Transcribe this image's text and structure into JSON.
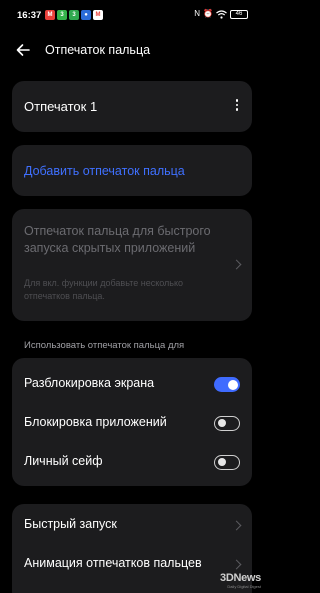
{
  "status_bar": {
    "time": "16:37",
    "apps": [
      {
        "icon": "red-app-icon",
        "color": "#e8403a",
        "glyph": "M"
      },
      {
        "icon": "green-app-icon",
        "color": "#34b34a",
        "glyph": "3"
      },
      {
        "icon": "green-app-icon-2",
        "color": "#2fa84f",
        "glyph": "3"
      },
      {
        "icon": "blue-app-icon",
        "color": "#2b6cd8",
        "glyph": "●"
      },
      {
        "icon": "gmail-icon",
        "color": "#ffffff",
        "glyph": "M"
      }
    ],
    "nfc": "N",
    "alarm": "⏰",
    "wifi": "wifi",
    "battery": "46"
  },
  "header": {
    "title": "Отпечаток пальца"
  },
  "fingerprint_card": {
    "name": "Отпечаток 1"
  },
  "add_card": {
    "label": "Добавить отпечаток пальца"
  },
  "quick_launch_card": {
    "title": "Отпечаток пальца для быстрого запуска скрытых приложений",
    "description": "Для вкл. функции добавьте несколько отпечатков пальца."
  },
  "usage_section": {
    "label": "Использовать отпечаток пальца для",
    "items": [
      {
        "label": "Разблокировка экрана",
        "enabled": true
      },
      {
        "label": "Блокировка приложений",
        "enabled": false
      },
      {
        "label": "Личный сейф",
        "enabled": false
      }
    ]
  },
  "bottom_card": {
    "items": [
      {
        "label": "Быстрый запуск"
      },
      {
        "label": "Анимация отпечатков пальцев"
      }
    ]
  },
  "watermark": {
    "logo": "3DNews",
    "sub": "Daily Digital Digest"
  },
  "colors": {
    "accent": "#3f70ff",
    "background": "#000000",
    "card": "#1c1c1e"
  }
}
